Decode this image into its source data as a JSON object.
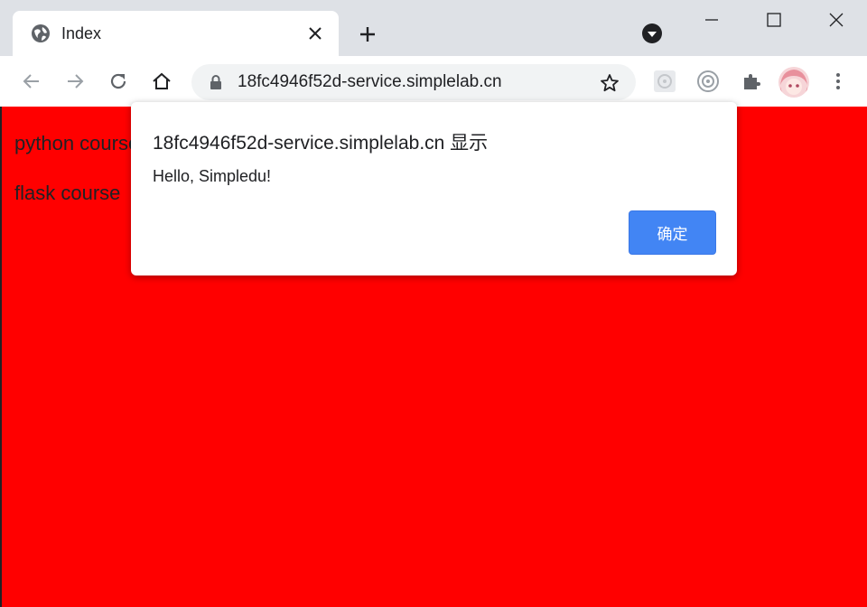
{
  "browser": {
    "tab": {
      "title": "Index",
      "favicon": "globe-icon"
    },
    "address_bar": {
      "url": "18fc4946f52d-service.simplelab.cn",
      "secure_icon": "lock-icon"
    },
    "toolbar_icons": [
      "back-icon",
      "forward-icon",
      "reload-icon",
      "home-icon",
      "star-icon",
      "extension-icon",
      "extension-icon-2",
      "puzzle-icon",
      "avatar",
      "more-icon"
    ]
  },
  "page": {
    "background": "#ff0000",
    "courses": [
      "python course",
      "flask course"
    ]
  },
  "dialog": {
    "title": "18fc4946f52d-service.simplelab.cn 显示",
    "message": "Hello, Simpledu!",
    "ok_label": "确定",
    "ok_color": "#4285f4"
  }
}
